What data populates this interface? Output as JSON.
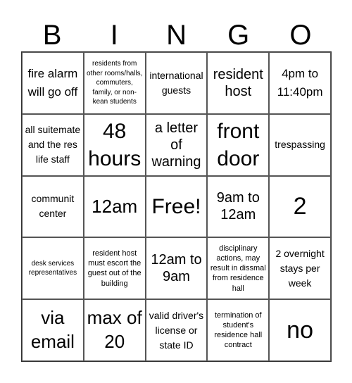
{
  "header": {
    "letters": [
      "B",
      "I",
      "N",
      "G",
      "O"
    ]
  },
  "cells": [
    "fire alarm will go off",
    "residents from other rooms/halls, commuters, family, or non-kean students",
    "international guests",
    "resident host",
    "4pm to 11:40pm",
    "all suitemate and the res life staff",
    "48 hours",
    "a letter of warning",
    "front door",
    "trespassing",
    "communit center",
    "12am",
    "Free!",
    "9am to 12am",
    "2",
    "desk services representatives",
    "resident host must escort the guest out of the building",
    "12am to 9am",
    "disciplinary actions, may result in dissmal from residence hall",
    "2 overnight stays per week",
    "via email",
    "max of 20",
    "valid driver's license or state ID",
    "termination of student's residence hall contract",
    "no"
  ]
}
